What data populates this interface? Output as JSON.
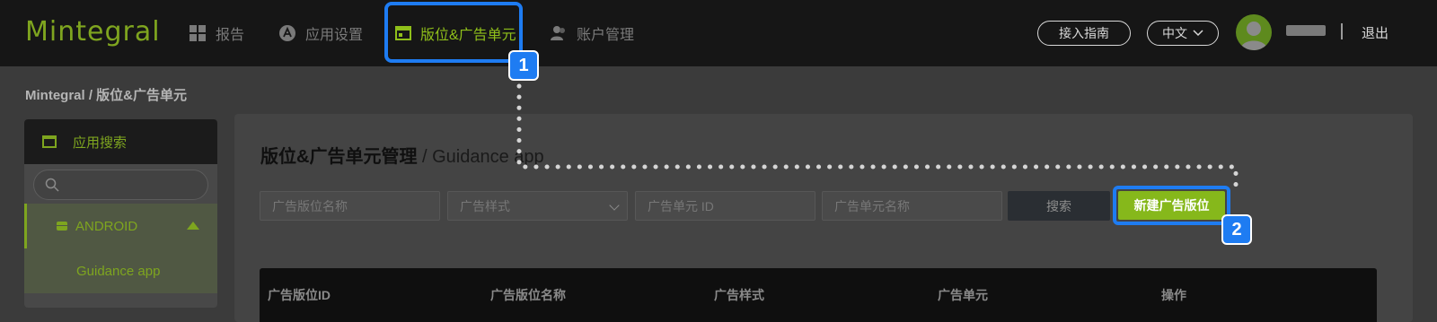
{
  "header": {
    "logo": "Mintegral",
    "nav": [
      {
        "label": "报告"
      },
      {
        "label": "应用设置"
      },
      {
        "label": "版位&广告单元"
      },
      {
        "label": "账户管理"
      }
    ],
    "guide_label": "接入指南",
    "lang_label": "中文",
    "logout_label": "退出"
  },
  "breadcrumb": "Mintegral / 版位&广告单元",
  "sidebar": {
    "head_label": "应用搜索",
    "platform_label": "ANDROID",
    "app_label": "Guidance app"
  },
  "main": {
    "title_bold": "版位&广告单元管理",
    "title_rest": " / Guidance app",
    "filters": {
      "placement_name_placeholder": "广告版位名称",
      "ad_style_placeholder": "广告样式",
      "ad_unit_id_placeholder": "广告单元 ID",
      "ad_unit_name_placeholder": "广告单元名称"
    },
    "search_label": "搜索",
    "new_placement_label": "新建广告版位"
  },
  "table": {
    "columns": [
      "广告版位ID",
      "广告版位名称",
      "广告样式",
      "广告单元",
      "操作"
    ]
  },
  "steps": [
    "1",
    "2"
  ],
  "colors": {
    "accent": "#86b81b",
    "highlight": "#1e7cf2"
  }
}
